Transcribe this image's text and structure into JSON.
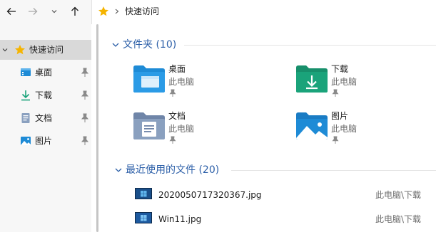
{
  "address": {
    "path": "快速访问"
  },
  "sidebar": {
    "quick_access_label": "快速访问",
    "items": [
      {
        "label": "桌面",
        "icon": "desktop-icon"
      },
      {
        "label": "下载",
        "icon": "download-icon"
      },
      {
        "label": "文档",
        "icon": "document-icon"
      },
      {
        "label": "图片",
        "icon": "pictures-icon"
      }
    ]
  },
  "main": {
    "folders_group": {
      "title": "文件夹 (10)",
      "folders": [
        {
          "name": "桌面",
          "location": "此电脑"
        },
        {
          "name": "下载",
          "location": "此电脑"
        },
        {
          "name": "文档",
          "location": "此电脑"
        },
        {
          "name": "图片",
          "location": "此电脑"
        }
      ]
    },
    "recent_group": {
      "title": "最近使用的文件 (20)",
      "files": [
        {
          "name": "2020050717320367.jpg",
          "location": "此电脑\\下载"
        },
        {
          "name": "Win11.jpg",
          "location": "此电脑\\下载"
        }
      ]
    }
  },
  "colors": {
    "accent_text": "#2c5fa8",
    "folder_blue": "#1e8bd6",
    "folder_green": "#1aa37a",
    "star": "#f5b400"
  }
}
